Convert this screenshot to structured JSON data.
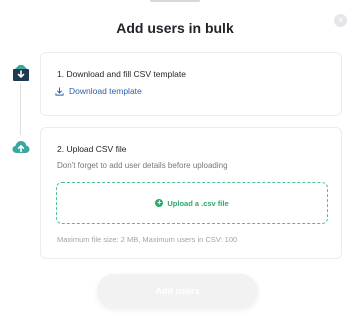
{
  "modal": {
    "title": "Add users in bulk",
    "close_glyph": "×"
  },
  "steps": [
    {
      "title": "1. Download and fill CSV template",
      "link_label": "Download template",
      "icon": "download-box-icon"
    },
    {
      "title": "2. Upload CSV file",
      "subtitle": "Don't forget to add user details before uploading",
      "upload_label": "Upload a .csv file",
      "hint": "Maximum file size: 2 MB, Maximum users in CSV: 100",
      "icon": "cloud-upload-icon"
    }
  ],
  "footer": {
    "submit_label": "Add users",
    "submit_disabled": true
  },
  "colors": {
    "accent_green": "#2aa86a",
    "link_blue": "#2d5fa8",
    "icon_dark": "#1e3a4f",
    "icon_teal": "#3aa7a0"
  }
}
